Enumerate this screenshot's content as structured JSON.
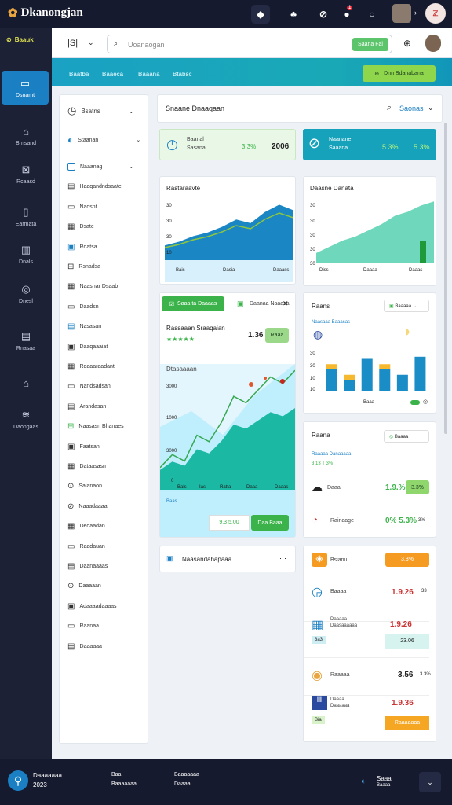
{
  "app": {
    "title": "Dkanongjan"
  },
  "topbar": {
    "icons": [
      "shield-icon",
      "cart-icon",
      "chat-icon",
      "bell-icon",
      "circle-icon"
    ],
    "badge": "1"
  },
  "leftnav": {
    "items": [
      {
        "label": "Dsnamt",
        "icon": "monitor-icon"
      },
      {
        "label": "Brnsand",
        "icon": "box-icon"
      },
      {
        "label": "Rcaasd",
        "icon": "grid-icon"
      },
      {
        "label": "Earmata",
        "icon": "doc-icon"
      },
      {
        "label": "Dnals",
        "icon": "building-icon"
      },
      {
        "label": "Dnesl",
        "icon": "clock-icon"
      },
      {
        "label": "Rnasaa",
        "icon": "calendar-icon"
      },
      {
        "label": "",
        "icon": "chart-icon"
      },
      {
        "label": "Daongaas",
        "icon": "stack-icon"
      }
    ],
    "logo": "Baauk"
  },
  "header": {
    "label": "|S|",
    "search_placeholder": "Uoanaogan",
    "search_button": "Saana Fal"
  },
  "tabs": [
    "Baatba",
    "Baaeca",
    "Baaana",
    "Btabsc"
  ],
  "tabbar_button": "Dnn Bdanabana",
  "side_list": [
    {
      "label": "Bsatns"
    },
    {
      "label": "Staanan"
    },
    {
      "label": "Naaanag"
    },
    {
      "label": "Haaqandndsaate"
    },
    {
      "label": "Nadsnt"
    },
    {
      "label": "Dsate"
    },
    {
      "label": "Rdatsa"
    },
    {
      "label": "Rsnadsa"
    },
    {
      "label": "Naasnar Dsaab"
    },
    {
      "label": "Daadsn"
    },
    {
      "label": "Nasasan"
    },
    {
      "label": "Daaqaaaiat"
    },
    {
      "label": "Rdaaaraadant"
    },
    {
      "label": "Nandsadsan"
    },
    {
      "label": "Arandasan"
    },
    {
      "label": "Naasasn Bhanaes"
    },
    {
      "label": "Faatsan"
    },
    {
      "label": "Dataasasn"
    },
    {
      "label": "Saianaon"
    },
    {
      "label": "Naaadaaaa"
    },
    {
      "label": "Deoaadan"
    },
    {
      "label": "Raadauan"
    },
    {
      "label": "Daanaaaas"
    },
    {
      "label": "Daaaaan"
    },
    {
      "label": "Adaaaadaaaas"
    },
    {
      "label": "Raanaa"
    },
    {
      "label": "Daaaaaa"
    }
  ],
  "content_header": {
    "title": "Snaane Dnaaqaan",
    "action": "Saonas"
  },
  "stat_cards": [
    {
      "title": "Baanal",
      "sub": "Sasana",
      "pct": "3.3%",
      "value": "2006"
    },
    {
      "title": "Naanane",
      "sub": "Saaana",
      "pct": "5.3%",
      "value": "5.3%"
    }
  ],
  "chart_left": {
    "title": "Rastaraavte",
    "ticks": [
      "30",
      "30",
      "30",
      "10"
    ],
    "xticks": [
      "Bais",
      "Dasia",
      "Daaass"
    ]
  },
  "chart_right": {
    "title": "Daasne Danata",
    "ticks": [
      "30",
      "30",
      "30",
      "30",
      "30"
    ],
    "xticks": [
      "Diss",
      "Daaaa",
      "Daaas"
    ]
  },
  "promo": {
    "button": "Saaa ta Daaaas",
    "title": "Daanaa Naaasa",
    "rating_title": "Rassaaan Sraaqaian",
    "value": "1.36",
    "chip": "Raaa"
  },
  "chart_big": {
    "title": "Dtasaaaan",
    "ticks": [
      "3000",
      "1000",
      "3000",
      "0"
    ],
    "xticks": [
      "Bals",
      "Ias",
      "Ratta",
      "Daaa",
      "Daaas"
    ],
    "foot_value": "9.3 5.00",
    "foot_button": "Daa Baaa",
    "foot_label": "Baas"
  },
  "bar_panel": {
    "title": "Raans",
    "select": "Baaaaa",
    "sub": "Naasaaa Baaasas",
    "ticks": [
      "30",
      "30",
      "10",
      "10"
    ],
    "footer": "Baaa"
  },
  "chart_data": {
    "type": "bar",
    "categories": [
      "1",
      "2",
      "3",
      "4",
      "5",
      "6"
    ],
    "series": [
      {
        "values": [
          20,
          10,
          30,
          20,
          15,
          32
        ]
      },
      {
        "values": [
          5,
          5,
          0,
          5,
          0,
          0
        ]
      }
    ],
    "ylim": [
      0,
      40
    ]
  },
  "line_chart_left": {
    "type": "area",
    "values": [
      8,
      10,
      13,
      15,
      18,
      22,
      20,
      26,
      30,
      27
    ]
  },
  "line_chart_right": {
    "type": "area",
    "values": [
      5,
      8,
      11,
      13,
      16,
      19,
      23,
      25,
      28,
      30
    ]
  },
  "kpi_panel": {
    "title": "Raana",
    "select": "Baaaa",
    "sub": "Raaaaa Danaaaaa",
    "sub2": "3 13 T 3%",
    "rows": [
      {
        "label": "Daaa",
        "value": "1.9.%",
        "chip": "3.3%"
      },
      {
        "label": "Rainaage",
        "value": "0% 5.3%",
        "chip": "3%"
      }
    ]
  },
  "task_panel": {
    "title": "Naasandahapaaa"
  },
  "list_panel": {
    "rows": [
      {
        "title": "Bsianu",
        "value": "",
        "chip": "3.3%",
        "chip2": "Saaa"
      },
      {
        "title": "Baaaa",
        "value": "1.9.26",
        "chip": "33"
      },
      {
        "title": "Daaaaa",
        "sub": "Daasaaaaaa",
        "value": "1.9.26",
        "chip": "23.06",
        "chip2": "3a3"
      },
      {
        "title": "Raaaaa",
        "value": "3.56",
        "chip": "3.3%"
      },
      {
        "title": "Daaaa",
        "sub": "Daaaaaa",
        "value": "1.9.36",
        "chip": "3.3%",
        "btn": "Raaaaaaa"
      }
    ]
  },
  "footer": {
    "brand": "Daaaaaaa",
    "sub": "2023",
    "col1a": "Baa",
    "col1b": "Baaaaaaa",
    "col2a": "Baaaaaaa",
    "col2b": "Daaaa",
    "right": "Saaa",
    "right2": "Baaaa"
  },
  "colors": {
    "accent": "#1a7fc3",
    "green": "#3bb34a",
    "teal": "#19a9b6",
    "navy": "#161a2e",
    "orange": "#f59b22"
  }
}
